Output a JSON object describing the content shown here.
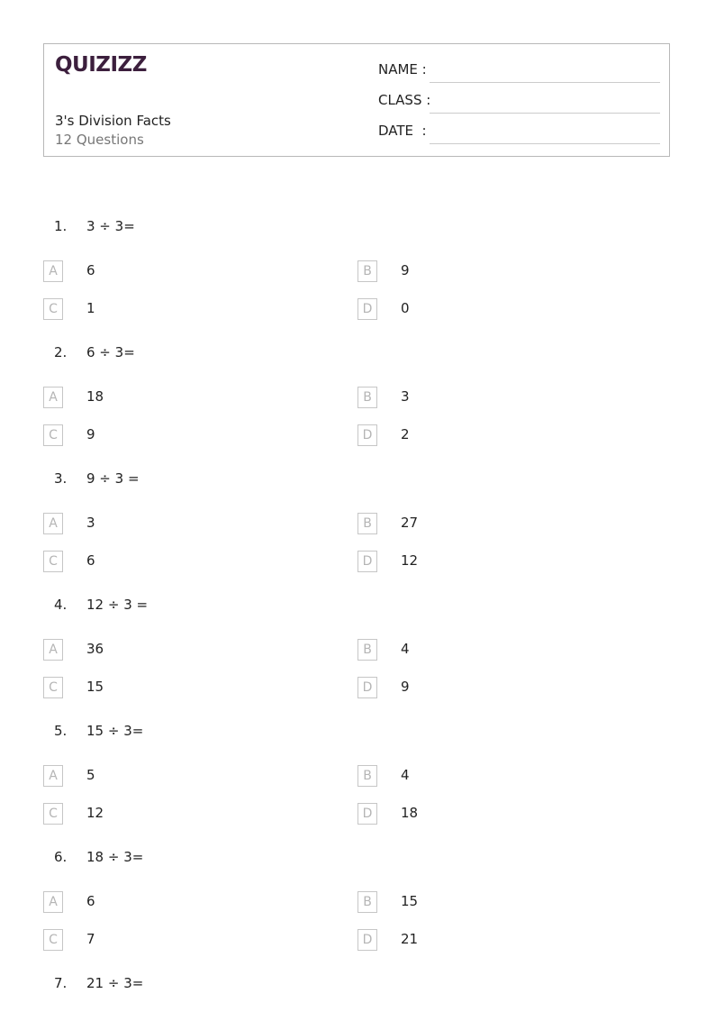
{
  "header": {
    "logo": "QUIZIZZ",
    "title": "3's Division Facts",
    "subtitle": "12 Questions",
    "fields": [
      {
        "label": "NAME :"
      },
      {
        "label": "CLASS :"
      },
      {
        "label": "DATE  :"
      }
    ]
  },
  "questions": [
    {
      "number": "1.",
      "text": "3 ÷ 3=",
      "options": [
        {
          "letter": "A",
          "text": "6"
        },
        {
          "letter": "B",
          "text": "9"
        },
        {
          "letter": "C",
          "text": "1"
        },
        {
          "letter": "D",
          "text": "0"
        }
      ]
    },
    {
      "number": "2.",
      "text": "6 ÷ 3=",
      "options": [
        {
          "letter": "A",
          "text": "18"
        },
        {
          "letter": "B",
          "text": "3"
        },
        {
          "letter": "C",
          "text": "9"
        },
        {
          "letter": "D",
          "text": "2"
        }
      ]
    },
    {
      "number": "3.",
      "text": "9 ÷ 3 =",
      "options": [
        {
          "letter": "A",
          "text": "3"
        },
        {
          "letter": "B",
          "text": "27"
        },
        {
          "letter": "C",
          "text": "6"
        },
        {
          "letter": "D",
          "text": "12"
        }
      ]
    },
    {
      "number": "4.",
      "text": "12 ÷ 3 =",
      "options": [
        {
          "letter": "A",
          "text": "36"
        },
        {
          "letter": "B",
          "text": "4"
        },
        {
          "letter": "C",
          "text": "15"
        },
        {
          "letter": "D",
          "text": "9"
        }
      ]
    },
    {
      "number": "5.",
      "text": "15 ÷ 3=",
      "options": [
        {
          "letter": "A",
          "text": "5"
        },
        {
          "letter": "B",
          "text": "4"
        },
        {
          "letter": "C",
          "text": "12"
        },
        {
          "letter": "D",
          "text": "18"
        }
      ]
    },
    {
      "number": "6.",
      "text": "18 ÷ 3=",
      "options": [
        {
          "letter": "A",
          "text": "6"
        },
        {
          "letter": "B",
          "text": "15"
        },
        {
          "letter": "C",
          "text": "7"
        },
        {
          "letter": "D",
          "text": "21"
        }
      ]
    },
    {
      "number": "7.",
      "text": "21 ÷ 3=",
      "options": []
    }
  ]
}
